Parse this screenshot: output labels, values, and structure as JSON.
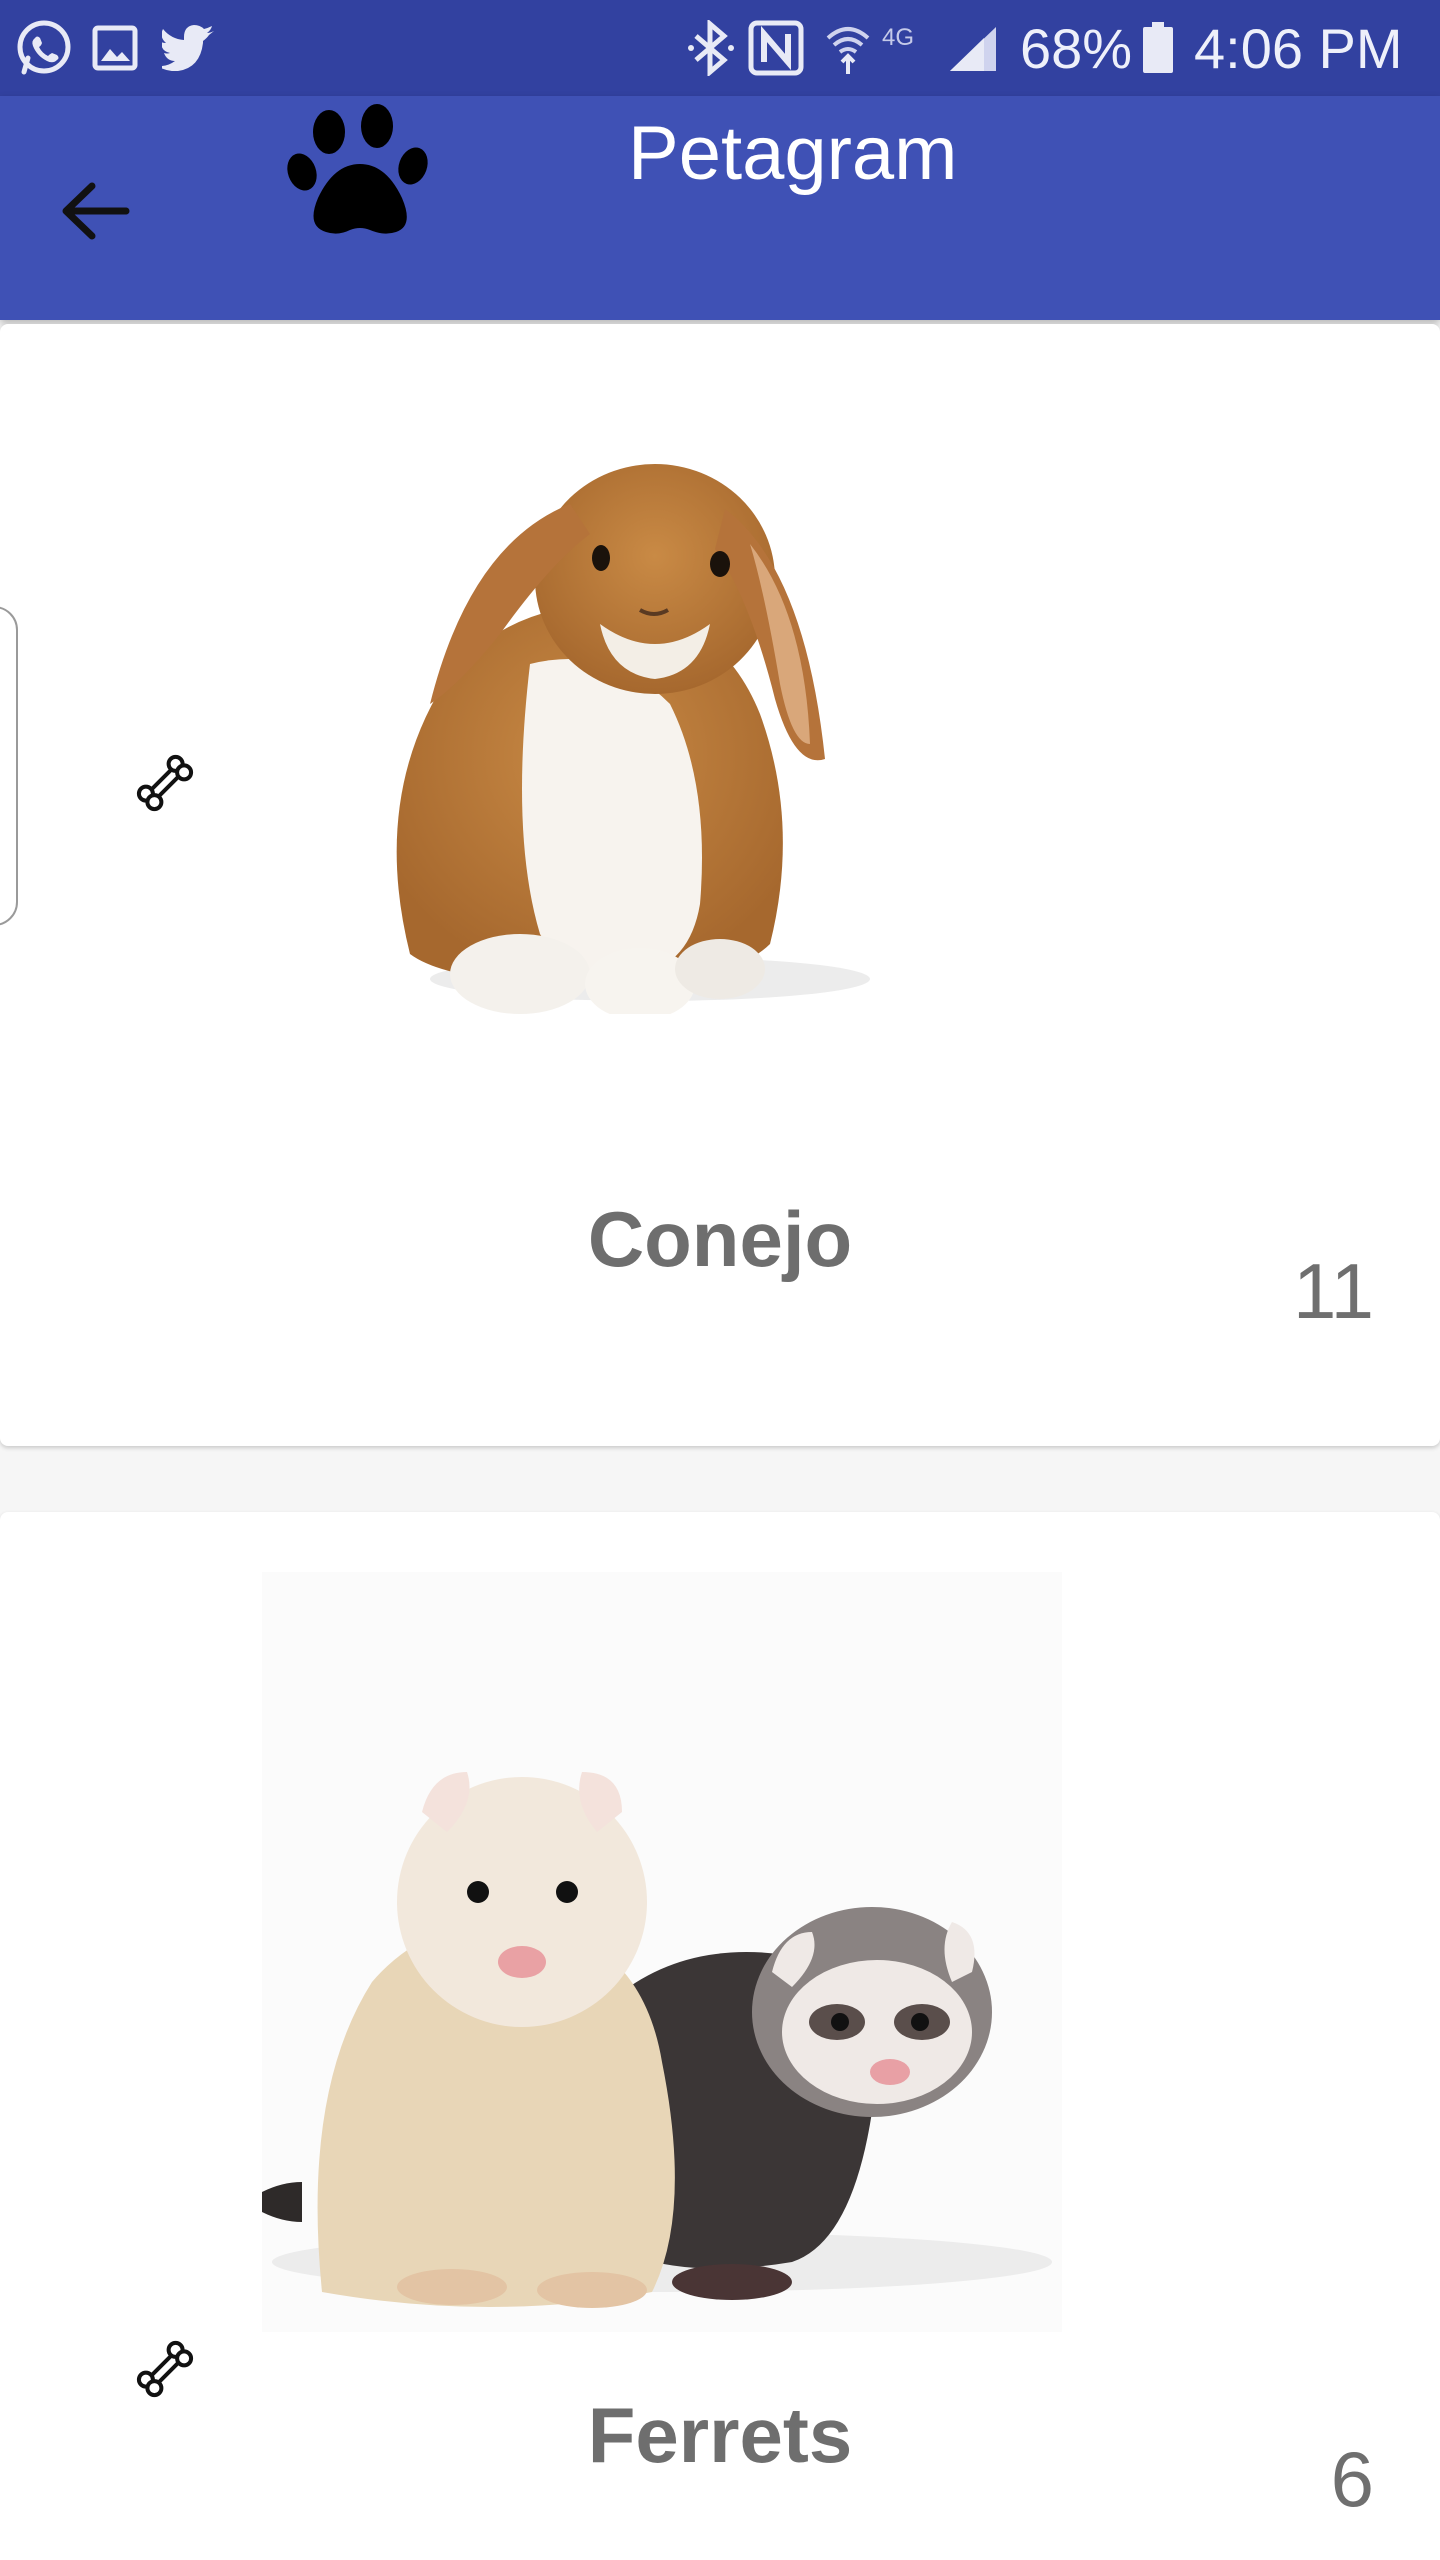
{
  "status_bar": {
    "battery": "68%",
    "time": "4:06 PM",
    "network": "4G",
    "icons": [
      "whatsapp-icon",
      "gallery-icon",
      "twitter-icon",
      "bluetooth-icon",
      "nfc-icon",
      "wifi-icon",
      "signal-icon",
      "battery-icon"
    ]
  },
  "app_bar": {
    "title": "Petagram",
    "back_icon": "arrow-back-icon",
    "logo_icon": "paw-icon",
    "background": "#3f51b5",
    "status_background": "#3241a0"
  },
  "pets": [
    {
      "name": "Conejo",
      "likes": "11",
      "like_icon": "bone-icon",
      "photo": "rabbit"
    },
    {
      "name": "Ferrets",
      "likes": "6",
      "like_icon": "bone-icon",
      "photo": "ferrets"
    }
  ]
}
